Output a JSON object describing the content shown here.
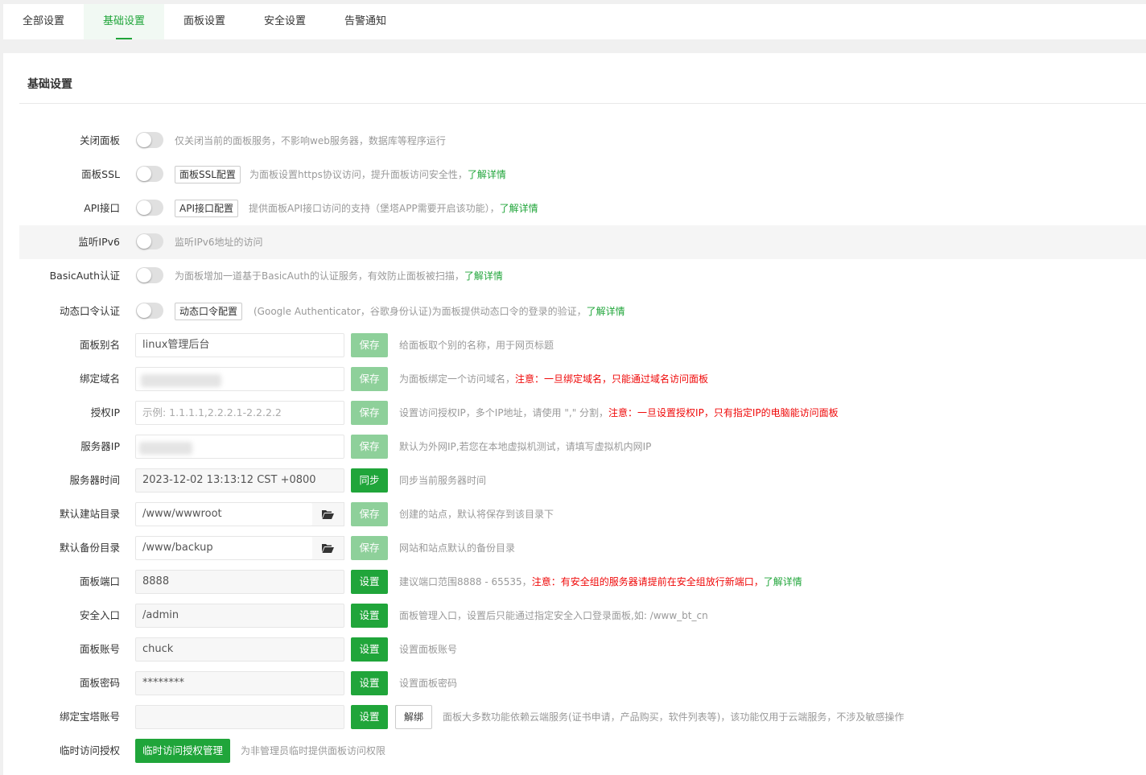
{
  "tabs": [
    {
      "label": "全部设置"
    },
    {
      "label": "基础设置"
    },
    {
      "label": "面板设置"
    },
    {
      "label": "安全设置"
    },
    {
      "label": "告警通知"
    }
  ],
  "section_title": "基础设置",
  "rows": {
    "close_panel": {
      "label": "关闭面板",
      "desc": "仅关闭当前的面板服务，不影响web服务器，数据库等程序运行"
    },
    "panel_ssl": {
      "label": "面板SSL",
      "button": "面板SSL配置",
      "desc": "为面板设置https协议访问，提升面板访问安全性，",
      "link": "了解详情"
    },
    "api": {
      "label": "API接口",
      "button": "API接口配置",
      "desc": "提供面板API接口访问的支持（堡塔APP需要开启该功能），",
      "link": "了解详情"
    },
    "ipv6": {
      "label": "监听IPv6",
      "desc": "监听IPv6地址的访问"
    },
    "basicauth": {
      "label": "BasicAuth认证",
      "desc": "为面板增加一道基于BasicAuth的认证服务，有效防止面板被扫描，",
      "link": "了解详情"
    },
    "totp": {
      "label": "动态口令认证",
      "button": "动态口令配置",
      "desc": "(Google Authenticator，谷歌身份认证)为面板提供动态口令的登录的验证，",
      "link": "了解详情"
    },
    "alias": {
      "label": "面板别名",
      "value": "linux管理后台",
      "button": "保存",
      "desc": "给面板取个别的名称，用于网页标题"
    },
    "domain": {
      "label": "绑定域名",
      "value": "",
      "button": "保存",
      "desc": "为面板绑定一个访问域名，",
      "warn": "注意：一旦绑定域名，只能通过域名访问面板"
    },
    "auth_ip": {
      "label": "授权IP",
      "placeholder": "示例: 1.1.1.1,2.2.2.1-2.2.2.2",
      "button": "保存",
      "desc": "设置访问授权IP，多个IP地址，请使用 \",\" 分割，",
      "warn": "注意：一旦设置授权IP，只有指定IP的电脑能访问面板"
    },
    "server_ip": {
      "label": "服务器IP",
      "value": "",
      "button": "保存",
      "desc": "默认为外网IP,若您在本地虚拟机测试，请填写虚拟机内网IP"
    },
    "server_time": {
      "label": "服务器时间",
      "value": "2023-12-02 13:13:12 CST +0800",
      "button": "同步",
      "desc": "同步当前服务器时间"
    },
    "site_dir": {
      "label": "默认建站目录",
      "value": "/www/wwwroot",
      "button": "保存",
      "desc": "创建的站点，默认将保存到该目录下"
    },
    "backup_dir": {
      "label": "默认备份目录",
      "value": "/www/backup",
      "button": "保存",
      "desc": "网站和站点默认的备份目录"
    },
    "port": {
      "label": "面板端口",
      "value": "8888",
      "button": "设置",
      "desc": "建议端口范围8888 - 65535，",
      "warn": "注意：有安全组的服务器请提前在安全组放行新端口，",
      "link": "了解详情"
    },
    "entry": {
      "label": "安全入口",
      "value": "/admin",
      "button": "设置",
      "desc": "面板管理入口，设置后只能通过指定安全入口登录面板,如: /www_bt_cn"
    },
    "account": {
      "label": "面板账号",
      "value": "chuck",
      "button": "设置",
      "desc": "设置面板账号"
    },
    "password": {
      "label": "面板密码",
      "value": "********",
      "button": "设置",
      "desc": "设置面板密码"
    },
    "bt_account": {
      "label": "绑定宝塔账号",
      "value": "",
      "button": "设置",
      "button2": "解绑",
      "desc": "面板大多数功能依赖云端服务(证书申请，产品购买，软件列表等)，该功能仅用于云端服务，不涉及敏感操作"
    },
    "temp_auth": {
      "label": "临时访问授权",
      "button": "临时访问授权管理",
      "desc": "为非管理员临时提供面板访问权限"
    }
  },
  "colors": {
    "accent": "#20a53a",
    "accent_disabled": "#8ed09a",
    "warn": "#ef0808",
    "muted": "#999999"
  },
  "icons": {
    "folder": "folder-open-icon"
  }
}
